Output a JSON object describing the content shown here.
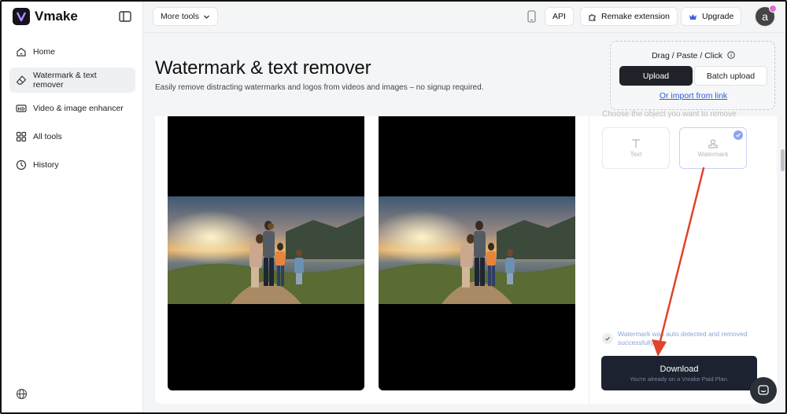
{
  "app": {
    "name": "Vmake"
  },
  "sidebar": {
    "items": [
      {
        "label": "Home",
        "icon": "home-icon",
        "active": false
      },
      {
        "label": "Watermark & text remover",
        "icon": "eraser-icon",
        "active": true
      },
      {
        "label": "Video & image enhancer",
        "icon": "hd-icon",
        "active": false
      },
      {
        "label": "All tools",
        "icon": "grid-icon",
        "active": false
      },
      {
        "label": "History",
        "icon": "clock-icon",
        "active": false
      }
    ]
  },
  "topbar": {
    "more_tools": "More tools",
    "api": "API",
    "remake_extension": "Remake extension",
    "upgrade": "Upgrade",
    "avatar_letter": "a"
  },
  "header": {
    "title": "Watermark & text remover",
    "subtitle": "Easily remove distracting watermarks and logos from videos and images – no signup required."
  },
  "upload": {
    "hint": "Drag / Paste / Click",
    "upload_label": "Upload",
    "batch_label": "Batch upload",
    "import_link": "Or import from link"
  },
  "options": {
    "choose_label": "Choose the object you want to remove",
    "text_label": "Text",
    "watermark_label": "Watermark",
    "selected": "Watermark"
  },
  "status": {
    "detected_text": "Watermark was auto detected and removed successfully"
  },
  "download": {
    "label": "Download",
    "sub": "You're already on a Vmake Paid Plan."
  },
  "colors": {
    "accent_dark": "#1c2230",
    "link": "#2f5cd8",
    "arrow": "#e0432c",
    "check": "#8ea5f3"
  }
}
